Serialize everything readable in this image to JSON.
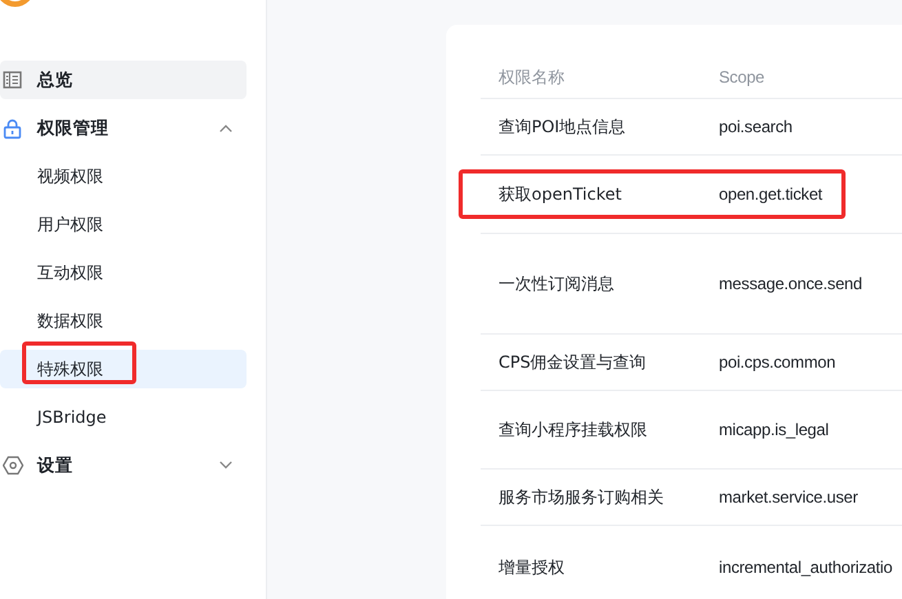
{
  "sidebar": {
    "items": [
      {
        "label": "总览",
        "hovered": true
      },
      {
        "label": "权限管理",
        "expanded": true,
        "children": [
          {
            "label": "视频权限",
            "selected": false,
            "highlighted": false
          },
          {
            "label": "用户权限",
            "selected": false,
            "highlighted": false
          },
          {
            "label": "互动权限",
            "selected": false,
            "highlighted": false
          },
          {
            "label": "数据权限",
            "selected": false,
            "highlighted": false
          },
          {
            "label": "特殊权限",
            "selected": true,
            "highlighted": true
          },
          {
            "label": "JSBridge",
            "selected": false,
            "highlighted": false
          }
        ]
      },
      {
        "label": "设置",
        "expanded": false
      }
    ]
  },
  "table": {
    "columns": [
      "权限名称",
      "Scope"
    ],
    "rows": [
      {
        "name": "查询POI地点信息",
        "scope": "poi.search",
        "highlighted": false
      },
      {
        "name": "获取openTicket",
        "scope": "open.get.ticket",
        "highlighted": true
      },
      {
        "name": "一次性订阅消息",
        "scope": "message.once.send",
        "highlighted": false
      },
      {
        "name": "CPS佣金设置与查询",
        "scope": "poi.cps.common",
        "highlighted": false
      },
      {
        "name": "查询小程序挂载权限",
        "scope": "micapp.is_legal",
        "highlighted": false
      },
      {
        "name": "服务市场服务订购相关",
        "scope": "market.service.user",
        "highlighted": false
      },
      {
        "name": "增量授权",
        "scope": "incremental_authorizatio",
        "highlighted": false
      }
    ]
  }
}
